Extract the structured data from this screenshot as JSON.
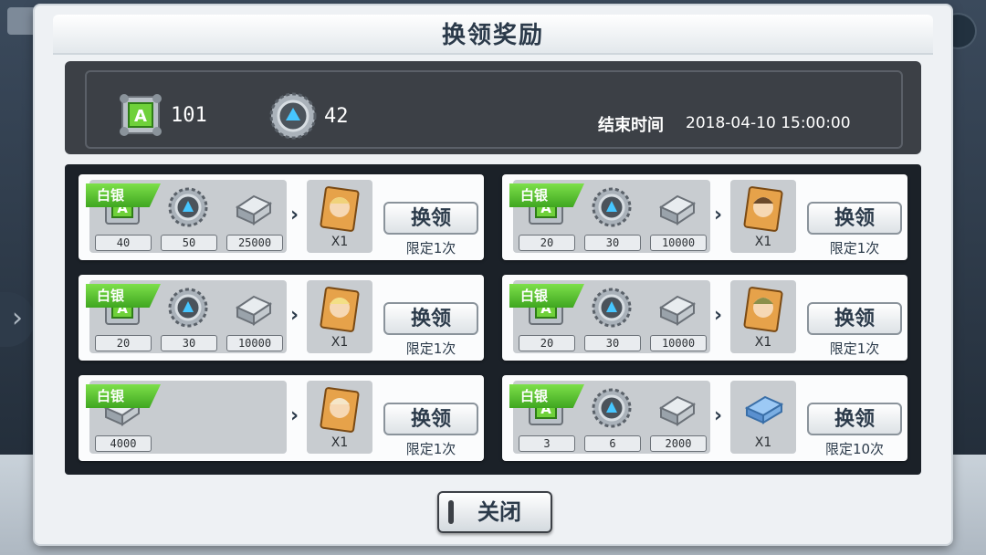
{
  "dialog": {
    "title": "换领奖励",
    "currencies": [
      {
        "icon": "a-ticket-icon",
        "amount": "101"
      },
      {
        "icon": "gear-coin-icon",
        "amount": "42"
      }
    ],
    "end_time_label": "结束时间",
    "end_time_value": "2018-04-10 15:00:00",
    "close_label": "关闭"
  },
  "cards": [
    {
      "badge": "白银",
      "costs": [
        "40",
        "50",
        "25000"
      ],
      "reward_count": "X1",
      "button": "换领",
      "limit": "限定1次"
    },
    {
      "badge": "白银",
      "costs": [
        "20",
        "30",
        "10000"
      ],
      "reward_count": "X1",
      "button": "换领",
      "limit": "限定1次"
    },
    {
      "badge": "白银",
      "costs": [
        "20",
        "30",
        "10000"
      ],
      "reward_count": "X1",
      "button": "换领",
      "limit": "限定1次"
    },
    {
      "badge": "白银",
      "costs": [
        "20",
        "30",
        "10000"
      ],
      "reward_count": "X1",
      "button": "换领",
      "limit": "限定1次"
    },
    {
      "badge": "白银",
      "costs": [
        "4000"
      ],
      "reward_count": "X1",
      "button": "换领",
      "limit": "限定1次"
    },
    {
      "badge": "白银",
      "costs": [
        "3",
        "6",
        "2000"
      ],
      "reward_count": "X1",
      "button": "换领",
      "limit": "限定10次"
    }
  ],
  "colors": {
    "badge_green": "#4cbb2a",
    "dark_panel": "#3c4046"
  }
}
